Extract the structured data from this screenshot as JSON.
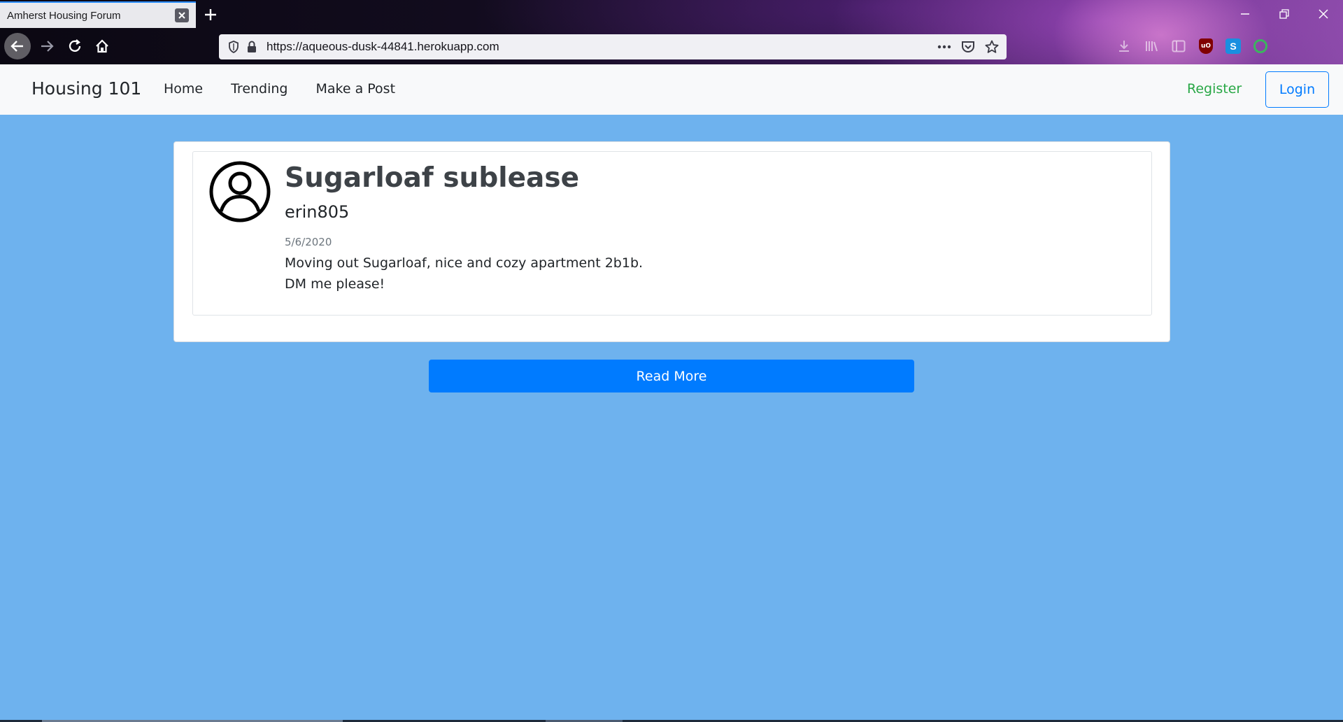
{
  "browser": {
    "tab_title": "Amherst Housing Forum",
    "url": "https://aqueous-dusk-44841.herokuapp.com",
    "extensions": {
      "ublock_label": "uO",
      "skype_label": "S"
    }
  },
  "site": {
    "brand": "Housing 101",
    "nav": {
      "home": "Home",
      "trending": "Trending",
      "make_post": "Make a Post",
      "register": "Register",
      "login": "Login"
    }
  },
  "post": {
    "title": "Sugarloaf sublease",
    "author": "erin805",
    "date": "5/6/2020",
    "body_line1": "Moving out Sugarloaf, nice and cozy apartment 2b1b.",
    "body_line2": "DM me please!"
  },
  "actions": {
    "read_more": "Read More"
  },
  "colors": {
    "page_background": "#6eb2ee",
    "primary": "#007bff",
    "register_green": "#28a745"
  }
}
